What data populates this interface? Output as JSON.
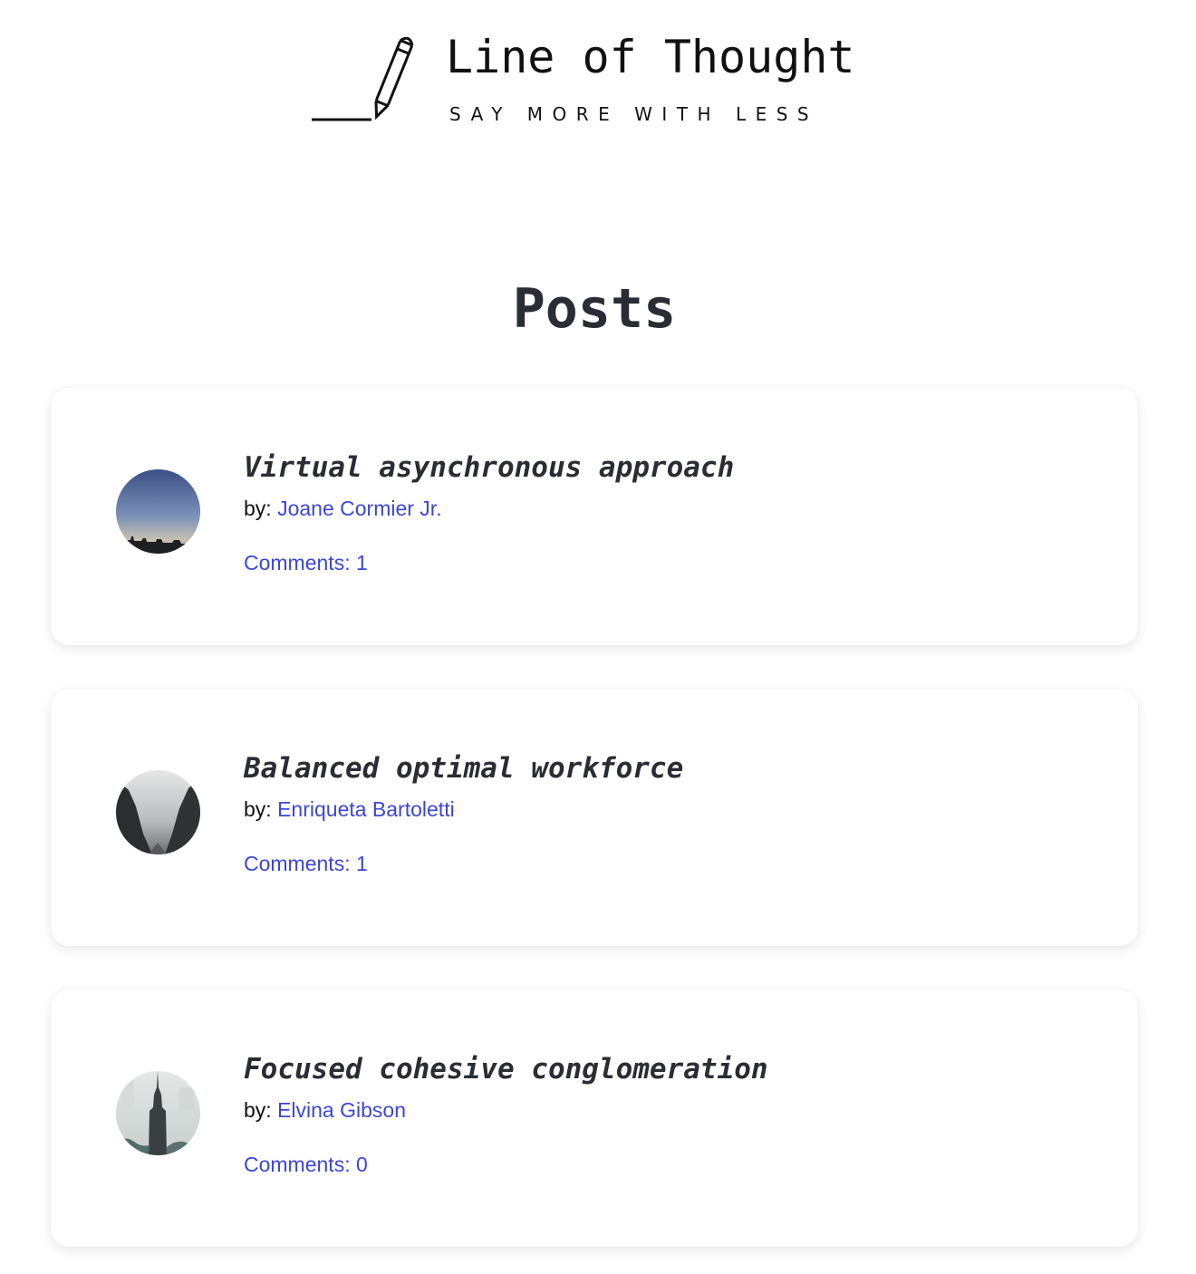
{
  "brand": {
    "title": "Line of Thought",
    "tagline": "SAY MORE WITH LESS",
    "icon": "pencil-line-icon"
  },
  "page": {
    "title": "Posts"
  },
  "colors": {
    "link": "#3c46d6",
    "heading": "#2a2d34"
  },
  "posts": [
    {
      "title": "Virtual asynchronous approach",
      "by_label": "by: ",
      "author": "Joane Cormier Jr.",
      "comments": "Comments: 1",
      "avatar": "city-skyline-dusk-thumbnail"
    },
    {
      "title": "Balanced optimal workforce",
      "by_label": "by: ",
      "author": "Enriqueta Bartoletti",
      "comments": "Comments: 1",
      "avatar": "misty-canyon-thumbnail"
    },
    {
      "title": "Focused cohesive conglomeration",
      "by_label": "by: ",
      "author": "Elvina Gibson",
      "comments": "Comments: 0",
      "avatar": "skyscraper-tower-thumbnail"
    }
  ]
}
